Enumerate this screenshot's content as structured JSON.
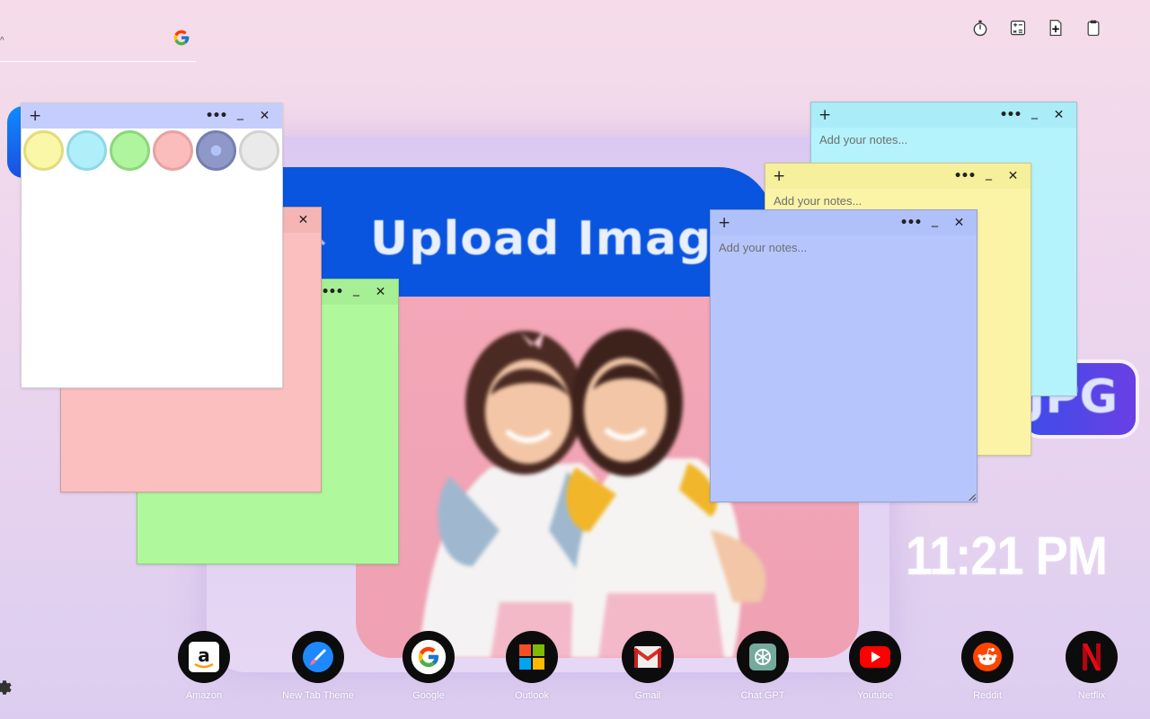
{
  "wallpaper": {
    "upload_text": "Upload Image",
    "badge_text": "JPG",
    "glyph": "↑",
    "colors": {
      "upload_bar": "#0a55df",
      "photo_bg": "#f3a7b7"
    }
  },
  "search": {
    "logo_icon": "google-g-icon"
  },
  "toolbar": {
    "buttons": [
      {
        "name": "timer-button",
        "icon": "stopwatch-icon"
      },
      {
        "name": "calculator-button",
        "icon": "calculator-icon"
      },
      {
        "name": "new-note-button",
        "icon": "note-plus-icon"
      },
      {
        "name": "clipboard-button",
        "icon": "clipboard-icon"
      }
    ]
  },
  "notes": {
    "placeholder": "Add your notes...",
    "controls": {
      "add": "+",
      "more": "•••",
      "minimize": "_",
      "close": "✕"
    },
    "colors": {
      "green": "#aff99c",
      "pink": "#fbbfbf",
      "white": "#ffffff",
      "cyan": "#b4f3fc",
      "yellow": "#fbf4a7",
      "blue": "#b6c6fc"
    },
    "swatches": [
      "#fbf4a7",
      "#b4f3fc",
      "#aff99c",
      "#fbbfbf",
      "#8f99c8",
      "#e8e8e8"
    ]
  },
  "clock": {
    "time": "11:21 PM"
  },
  "dock": [
    {
      "label": "Amazon",
      "icon": "amazon-icon"
    },
    {
      "label": "New Tab Theme",
      "icon": "paintbrush-icon"
    },
    {
      "label": "Google",
      "icon": "google-icon"
    },
    {
      "label": "Outlook",
      "icon": "microsoft-icon"
    },
    {
      "label": "Gmail",
      "icon": "gmail-icon"
    },
    {
      "label": "Chat GPT",
      "icon": "chatgpt-icon"
    },
    {
      "label": "Youtube",
      "icon": "youtube-icon"
    },
    {
      "label": "Reddit",
      "icon": "reddit-icon"
    },
    {
      "label": "Netflix",
      "icon": "netflix-icon"
    }
  ],
  "settings": {
    "icon": "gear-icon"
  }
}
